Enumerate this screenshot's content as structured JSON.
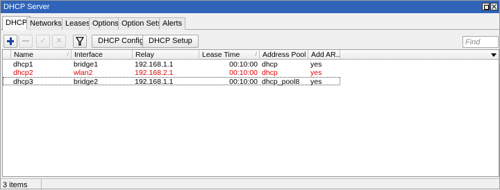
{
  "window": {
    "title": "DHCP Server"
  },
  "tabs": [
    {
      "label": "DHCP"
    },
    {
      "label": "Networks"
    },
    {
      "label": "Leases"
    },
    {
      "label": "Options"
    },
    {
      "label": "Option Sets"
    },
    {
      "label": "Alerts"
    }
  ],
  "toolbar": {
    "dhcp_config_label": "DHCP Config",
    "dhcp_setup_label": "DHCP Setup",
    "find_placeholder": "Find"
  },
  "table": {
    "columns": [
      "Name",
      "Interface",
      "Relay",
      "Lease Time",
      "Address Pool",
      "Add AR..."
    ],
    "rows": [
      {
        "name": "dhcp1",
        "interface": "bridge1",
        "relay": "192.168.1.1",
        "lease_time": "00:10:00",
        "address_pool": "dhcp",
        "add_arp": "yes",
        "disabled": false
      },
      {
        "name": "dhcp2",
        "interface": "wlan2",
        "relay": "192.168.2.1",
        "lease_time": "00:10:00",
        "address_pool": "dhcp",
        "add_arp": "yes",
        "disabled": true
      },
      {
        "name": "dhcp3",
        "interface": "bridge2",
        "relay": "192.168.1.1",
        "lease_time": "00:10:00",
        "address_pool": "dhcp_pool8",
        "add_arp": "yes",
        "disabled": false
      }
    ]
  },
  "status": {
    "item_count": "3 items"
  },
  "colors": {
    "titlebar": "#2f64b9",
    "disabled_row": "#e00000",
    "add_icon": "#1a3f9c"
  }
}
